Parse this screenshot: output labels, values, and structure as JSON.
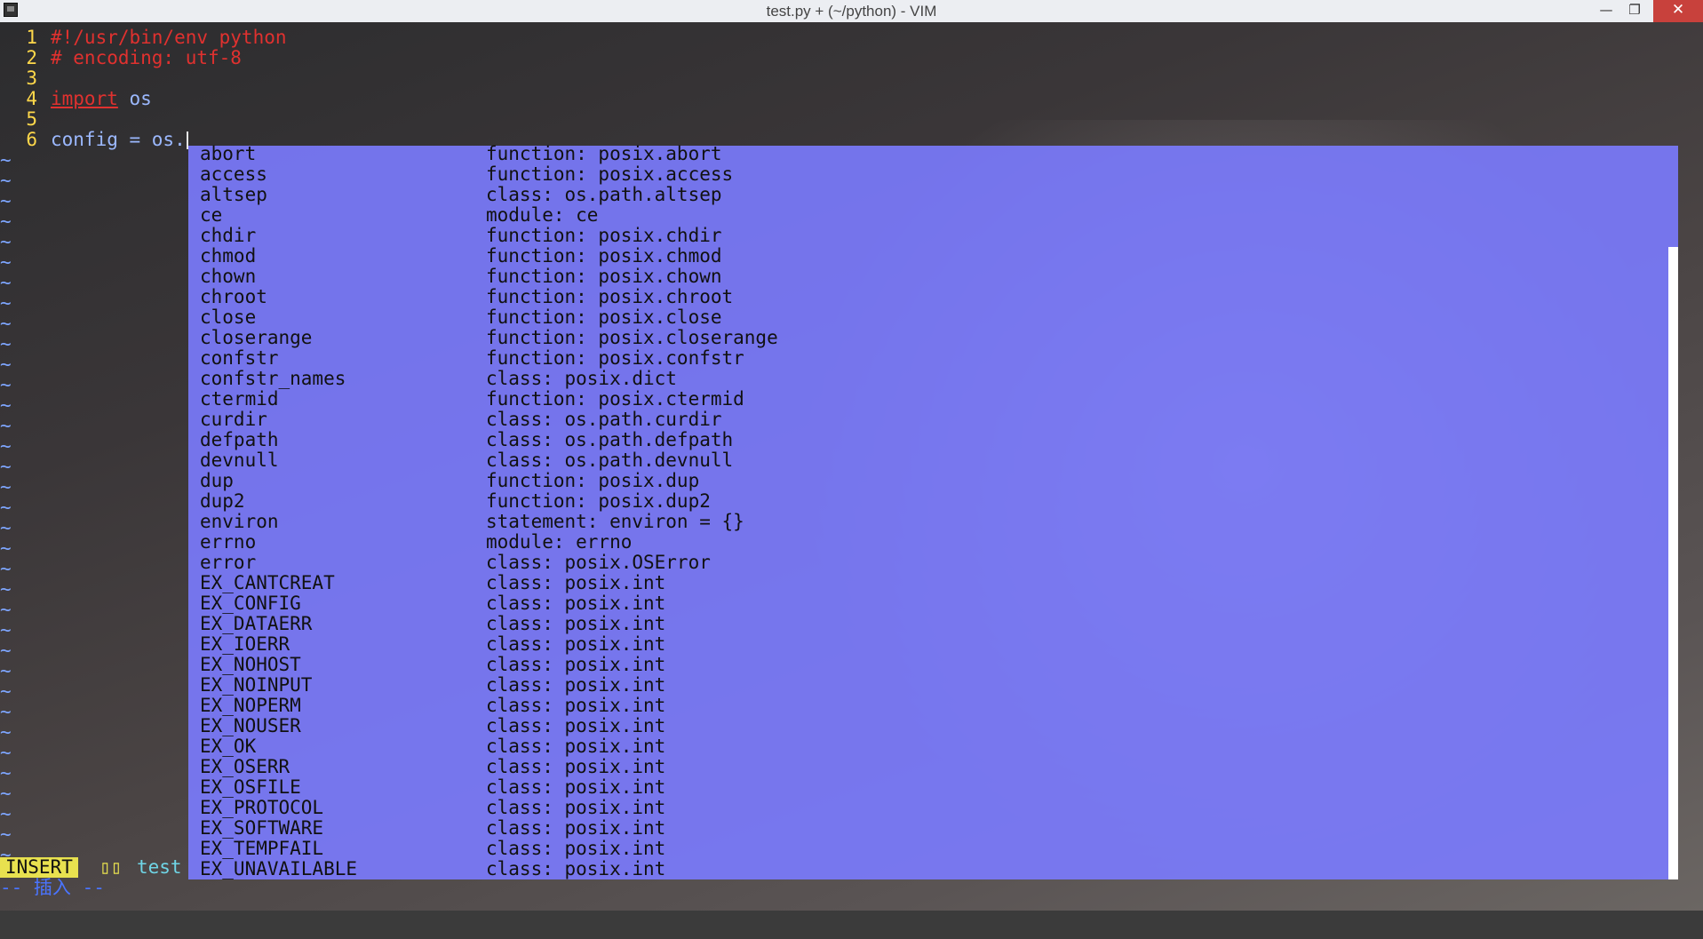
{
  "window": {
    "title": "test.py + (~/python) - VIM",
    "minimize_glyph": "—",
    "maximize_glyph": "❐",
    "close_glyph": "✕"
  },
  "buffer": {
    "lines": [
      {
        "num": "1",
        "text": "#!/usr/bin/env python",
        "style": "comment"
      },
      {
        "num": "2",
        "text": "# encoding: utf-8",
        "style": "comment"
      },
      {
        "num": "3",
        "text": "",
        "style": "normal"
      },
      {
        "num": "4",
        "keyword": "import",
        "text": " os",
        "style": "import"
      },
      {
        "num": "5",
        "text": "",
        "style": "normal"
      },
      {
        "num": "6",
        "text": "config = os.",
        "style": "normal",
        "cursor": true
      }
    ],
    "tilde_glyph": "~",
    "tilde_count": 36
  },
  "completion_menu": {
    "items": [
      {
        "word": "abort",
        "kind": "function: posix.abort"
      },
      {
        "word": "access",
        "kind": "function: posix.access"
      },
      {
        "word": "altsep",
        "kind": "class: os.path.altsep"
      },
      {
        "word": "ce",
        "kind": "module: ce"
      },
      {
        "word": "chdir",
        "kind": "function: posix.chdir"
      },
      {
        "word": "chmod",
        "kind": "function: posix.chmod"
      },
      {
        "word": "chown",
        "kind": "function: posix.chown"
      },
      {
        "word": "chroot",
        "kind": "function: posix.chroot"
      },
      {
        "word": "close",
        "kind": "function: posix.close"
      },
      {
        "word": "closerange",
        "kind": "function: posix.closerange"
      },
      {
        "word": "confstr",
        "kind": "function: posix.confstr"
      },
      {
        "word": "confstr_names",
        "kind": "class: posix.dict"
      },
      {
        "word": "ctermid",
        "kind": "function: posix.ctermid"
      },
      {
        "word": "curdir",
        "kind": "class: os.path.curdir"
      },
      {
        "word": "defpath",
        "kind": "class: os.path.defpath"
      },
      {
        "word": "devnull",
        "kind": "class: os.path.devnull"
      },
      {
        "word": "dup",
        "kind": "function: posix.dup"
      },
      {
        "word": "dup2",
        "kind": "function: posix.dup2"
      },
      {
        "word": "environ",
        "kind": "statement: environ = {}"
      },
      {
        "word": "errno",
        "kind": "module: errno"
      },
      {
        "word": "error",
        "kind": "class: posix.OSError"
      },
      {
        "word": "EX_CANTCREAT",
        "kind": "class: posix.int"
      },
      {
        "word": "EX_CONFIG",
        "kind": "class: posix.int"
      },
      {
        "word": "EX_DATAERR",
        "kind": "class: posix.int"
      },
      {
        "word": "EX_IOERR",
        "kind": "class: posix.int"
      },
      {
        "word": "EX_NOHOST",
        "kind": "class: posix.int"
      },
      {
        "word": "EX_NOINPUT",
        "kind": "class: posix.int"
      },
      {
        "word": "EX_NOPERM",
        "kind": "class: posix.int"
      },
      {
        "word": "EX_NOUSER",
        "kind": "class: posix.int"
      },
      {
        "word": "EX_OK",
        "kind": "class: posix.int"
      },
      {
        "word": "EX_OSERR",
        "kind": "class: posix.int"
      },
      {
        "word": "EX_OSFILE",
        "kind": "class: posix.int"
      },
      {
        "word": "EX_PROTOCOL",
        "kind": "class: posix.int"
      },
      {
        "word": "EX_SOFTWARE",
        "kind": "class: posix.int"
      },
      {
        "word": "EX_TEMPFAIL",
        "kind": "class: posix.int"
      },
      {
        "word": "EX_UNAVAILABLE",
        "kind": "class: posix.int"
      }
    ]
  },
  "statusline": {
    "mode": "INSERT",
    "flag": "▯▯",
    "filename": "test"
  },
  "cmdline": {
    "message": "-- 插入 --"
  },
  "colors": {
    "line_number": "#ffd84a",
    "comment": "#e0312f",
    "popup_bg": "#7b7bff",
    "mode_bg": "#e8e14f",
    "filename": "#6fd5e6"
  }
}
